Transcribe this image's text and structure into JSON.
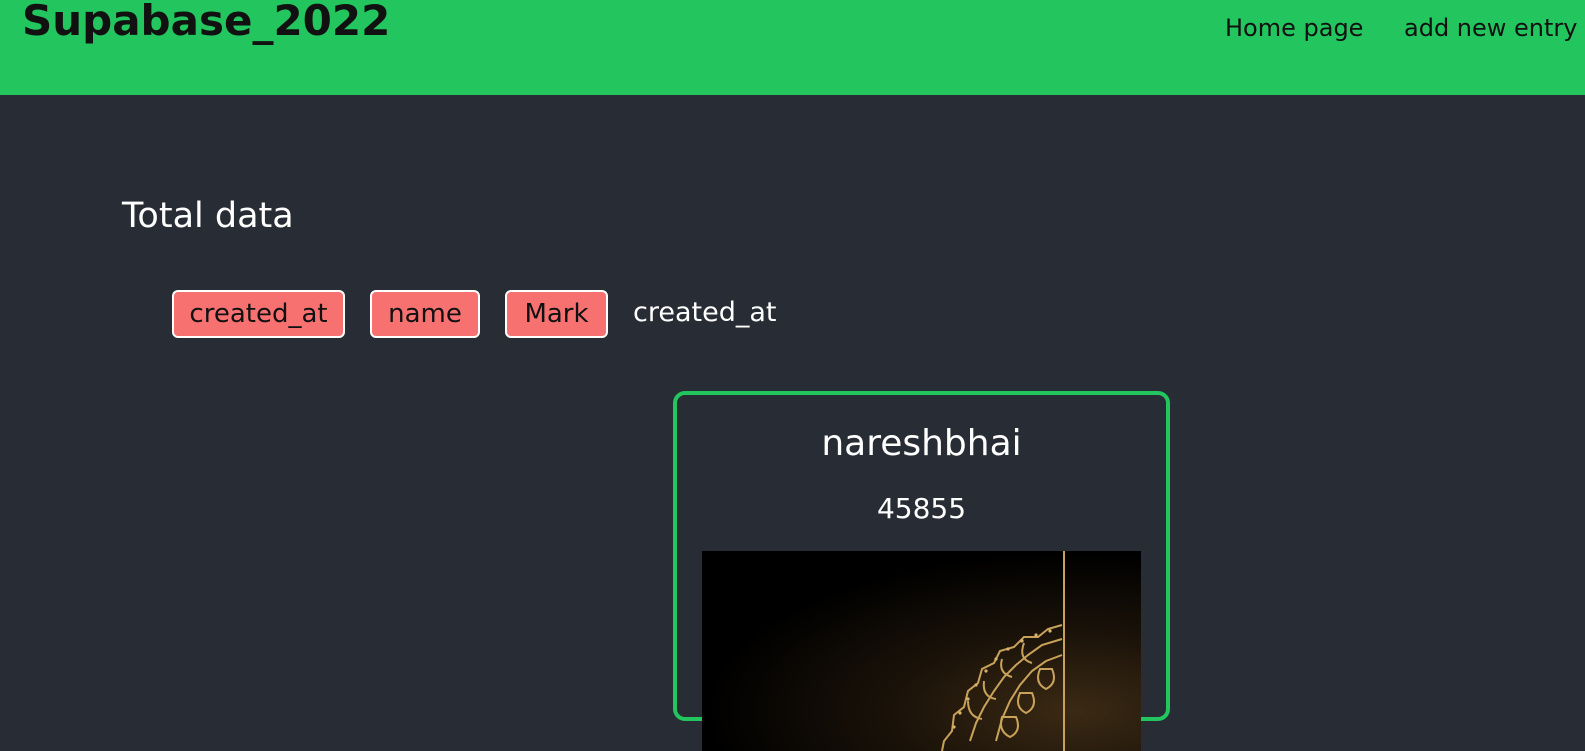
{
  "navbar": {
    "brand": "Supabase_2022",
    "links": [
      "Home page",
      "add new entry"
    ],
    "bg_color": "#22c55e"
  },
  "main": {
    "title": "Total data",
    "sort_buttons": [
      "created_at",
      "name",
      "Mark"
    ],
    "sort_status": "created_at",
    "button_color": "#f87171"
  },
  "cards": [
    {
      "name": "nareshbhai",
      "mark": "45855",
      "image": "golden-mandala-artwork",
      "border_color": "#22c55e"
    }
  ]
}
